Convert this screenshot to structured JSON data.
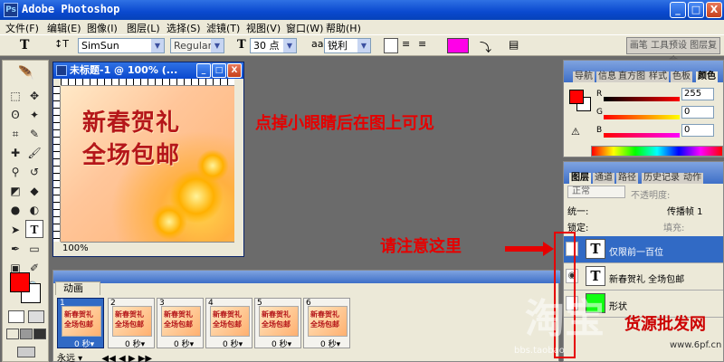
{
  "window": {
    "title": "Adobe Photoshop",
    "minimize": "_",
    "maximize": "□",
    "close": "X"
  },
  "menubar": [
    "文件(F)",
    "编辑(E)",
    "图像(I)",
    "图层(L)",
    "选择(S)",
    "滤镜(T)",
    "视图(V)",
    "窗口(W)",
    "帮助(H)"
  ],
  "options": {
    "tool_glyph": "T",
    "orientation_glyph": "↕T",
    "font_family": "SimSun",
    "font_style": "Regular",
    "size_icon": "T",
    "font_size": "30 点",
    "aa_icon": "aa",
    "antialias": "锐利",
    "text_color": "#ff00e8",
    "tool_presets_tab": "画笔 工具预设 图层复合"
  },
  "document": {
    "title": "未标题-1 @ 100% (...",
    "zoom": "100%",
    "canvas_text_line1": "新春贺礼",
    "canvas_text_line2": "全场包邮"
  },
  "annotations": {
    "note_top": "点掉小眼睛后在图上可见",
    "note_bottom": "请注意这里"
  },
  "animation": {
    "tab_label": "动画",
    "frames": [
      {
        "num": "1",
        "delay": "0 秒▾"
      },
      {
        "num": "2",
        "delay": "0 秒▾"
      },
      {
        "num": "3",
        "delay": "0 秒▾"
      },
      {
        "num": "4",
        "delay": "0 秒▾"
      },
      {
        "num": "5",
        "delay": "0 秒▾"
      },
      {
        "num": "6",
        "delay": "0 秒▾"
      }
    ],
    "loop": "永远 ▾",
    "controls": "◀◀ ◀ ▶ ▶▶"
  },
  "color_panel": {
    "tabs": [
      "导航",
      "信息",
      "直方图",
      "样式",
      "色板",
      "颜色"
    ],
    "active_tab": "颜色",
    "r_label": "R",
    "g_label": "G",
    "b_label": "B",
    "r": "255",
    "g": "0",
    "b": "0",
    "fg": "#ff0000",
    "warning": "⚠"
  },
  "layers_panel": {
    "tabs": [
      "图层",
      "通道",
      "路径",
      "历史记录",
      "动作"
    ],
    "blend_mode": "正常",
    "opacity_label": "不透明度:",
    "unify_label": "统一:",
    "propagate_label": "传播帧 1",
    "lock_label": "锁定:",
    "fill_label": "填充:",
    "layers": [
      {
        "name": "仅限前一百位",
        "thumb": "T",
        "eye": ""
      },
      {
        "name": "新春贺礼 全场包邮",
        "thumb": "T",
        "eye": "◉"
      },
      {
        "name": "形状",
        "thumb": "",
        "eye": ""
      }
    ]
  },
  "watermark": {
    "big": "淘宝",
    "red": "货源批发网",
    "small": "bbs.taobao",
    "url": "www.6pf.cn"
  }
}
